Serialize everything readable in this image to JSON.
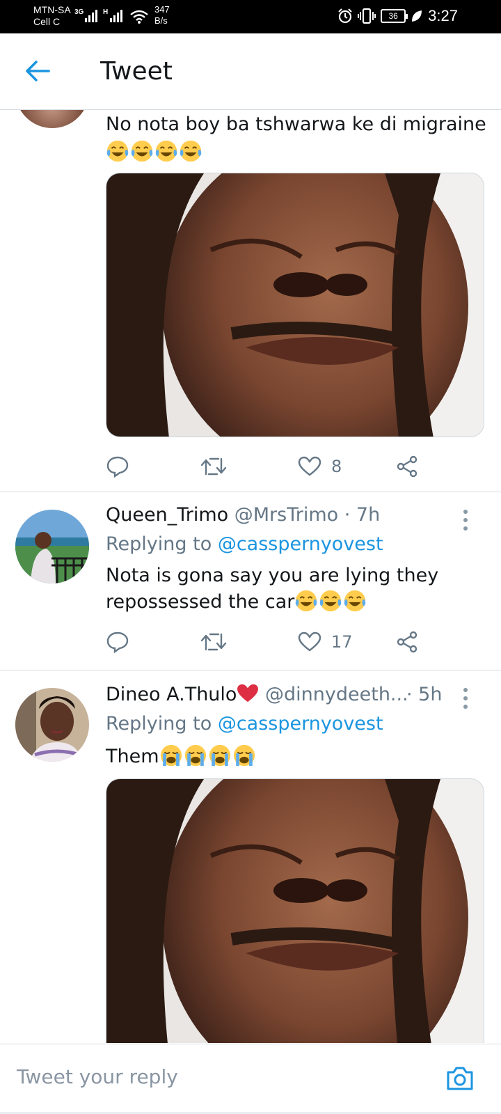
{
  "status_bar": {
    "carrier_1": "MTN-SA",
    "carrier_2": "Cell C",
    "net_1": "3G",
    "net_2": "H",
    "speed_value": "347",
    "speed_unit": "B/s",
    "battery": "36",
    "time": "3:27"
  },
  "header": {
    "title": "Tweet",
    "back_icon": "arrow-left-icon"
  },
  "tweets": [
    {
      "text": "No nota boy ba tshwarwa ke di migraine",
      "emoji": "face-with-tears-of-joy",
      "emoji_count": 4,
      "has_media": true,
      "like_count": "8"
    },
    {
      "name": "Queen_Trimo",
      "handle": "@MrsTrimo",
      "time": "· 7h",
      "replying_label": "Replying to",
      "replying_to": "@casspernyovest",
      "text_line1": "Nota is gona say you are lying they",
      "text_line2": "repossessed the car",
      "emoji": "face-with-tears-of-joy",
      "emoji_count": 3,
      "like_count": "17"
    },
    {
      "name": "Dineo A.Thulo",
      "name_emoji": "red-heart",
      "handle": "@dinnydeeth...",
      "time": "· 5h",
      "replying_label": "Replying to",
      "replying_to": "@casspernyovest",
      "text": "Them",
      "emoji": "loudly-crying-face",
      "emoji_count": 4,
      "has_media": true
    }
  ],
  "reply_bar": {
    "placeholder": "Tweet your reply",
    "camera_icon": "camera-icon"
  },
  "colors": {
    "accent": "#1b95e0",
    "text": "#14171a",
    "secondary": "#657786",
    "divider": "#d5dbe0",
    "heart": "#e0245e"
  }
}
